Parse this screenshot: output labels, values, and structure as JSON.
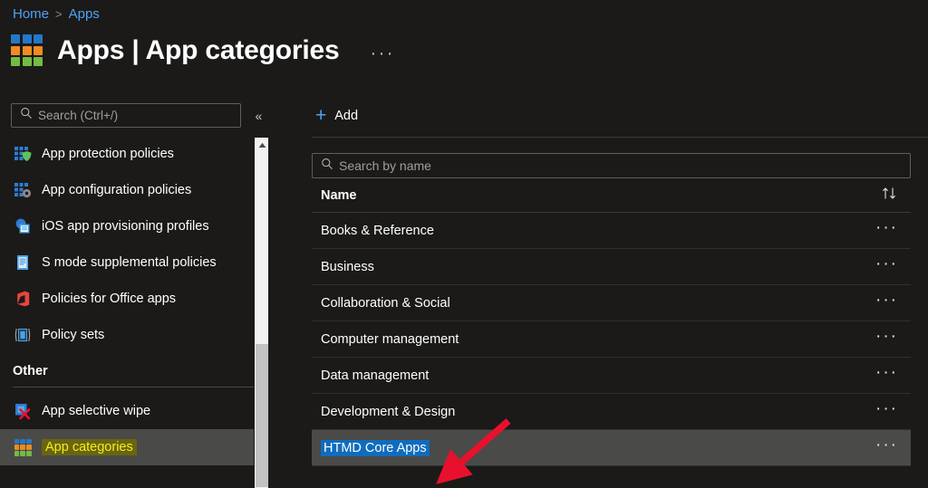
{
  "breadcrumb": {
    "items": [
      {
        "label": "Home"
      },
      {
        "label": "Apps"
      }
    ],
    "separator": ">"
  },
  "header": {
    "icon": "apps-grid-icon",
    "title": "Apps | App categories",
    "more_label": "···"
  },
  "sidebar": {
    "search": {
      "placeholder": "Search (Ctrl+/)",
      "value": "",
      "icon": "search-icon"
    },
    "collapse_label": "«",
    "items": [
      {
        "label": "App protection policies",
        "icon": "app-protection-icon"
      },
      {
        "label": "App configuration policies",
        "icon": "app-configuration-icon"
      },
      {
        "label": "iOS app provisioning profiles",
        "icon": "ios-provisioning-icon"
      },
      {
        "label": "S mode supplemental policies",
        "icon": "s-mode-icon"
      },
      {
        "label": "Policies for Office apps",
        "icon": "office-icon"
      },
      {
        "label": "Policy sets",
        "icon": "policy-sets-icon"
      }
    ],
    "section": {
      "title": "Other"
    },
    "other_items": [
      {
        "label": "App selective wipe",
        "icon": "selective-wipe-icon",
        "selected": false
      },
      {
        "label": "App categories",
        "icon": "app-categories-icon",
        "selected": true
      }
    ]
  },
  "main": {
    "toolbar": {
      "add_label": "Add",
      "add_icon": "plus-icon"
    },
    "search": {
      "placeholder": "Search by name",
      "value": "",
      "icon": "search-icon"
    },
    "table": {
      "columns": [
        "Name"
      ],
      "sort_icon": "sort-arrows-icon",
      "row_menu_label": "···",
      "rows": [
        {
          "name": "Books & Reference",
          "selected": false
        },
        {
          "name": "Business",
          "selected": false
        },
        {
          "name": "Collaboration & Social",
          "selected": false
        },
        {
          "name": "Computer management",
          "selected": false
        },
        {
          "name": "Data management",
          "selected": false
        },
        {
          "name": "Development & Design",
          "selected": false
        },
        {
          "name": "HTMD Core Apps",
          "selected": true
        }
      ]
    }
  },
  "annotation": {
    "type": "arrow",
    "color": "#e8112d",
    "points_at": "HTMD Core Apps"
  },
  "colors": {
    "background": "#1b1a19",
    "link": "#4da3f5",
    "selection_blue": "#0f6cbd",
    "selected_row": "#4a4a48",
    "highlight_yellow_text": "#f2ef1f",
    "highlight_yellow_bg": "#6b6410",
    "arrow_red": "#e8112d"
  }
}
